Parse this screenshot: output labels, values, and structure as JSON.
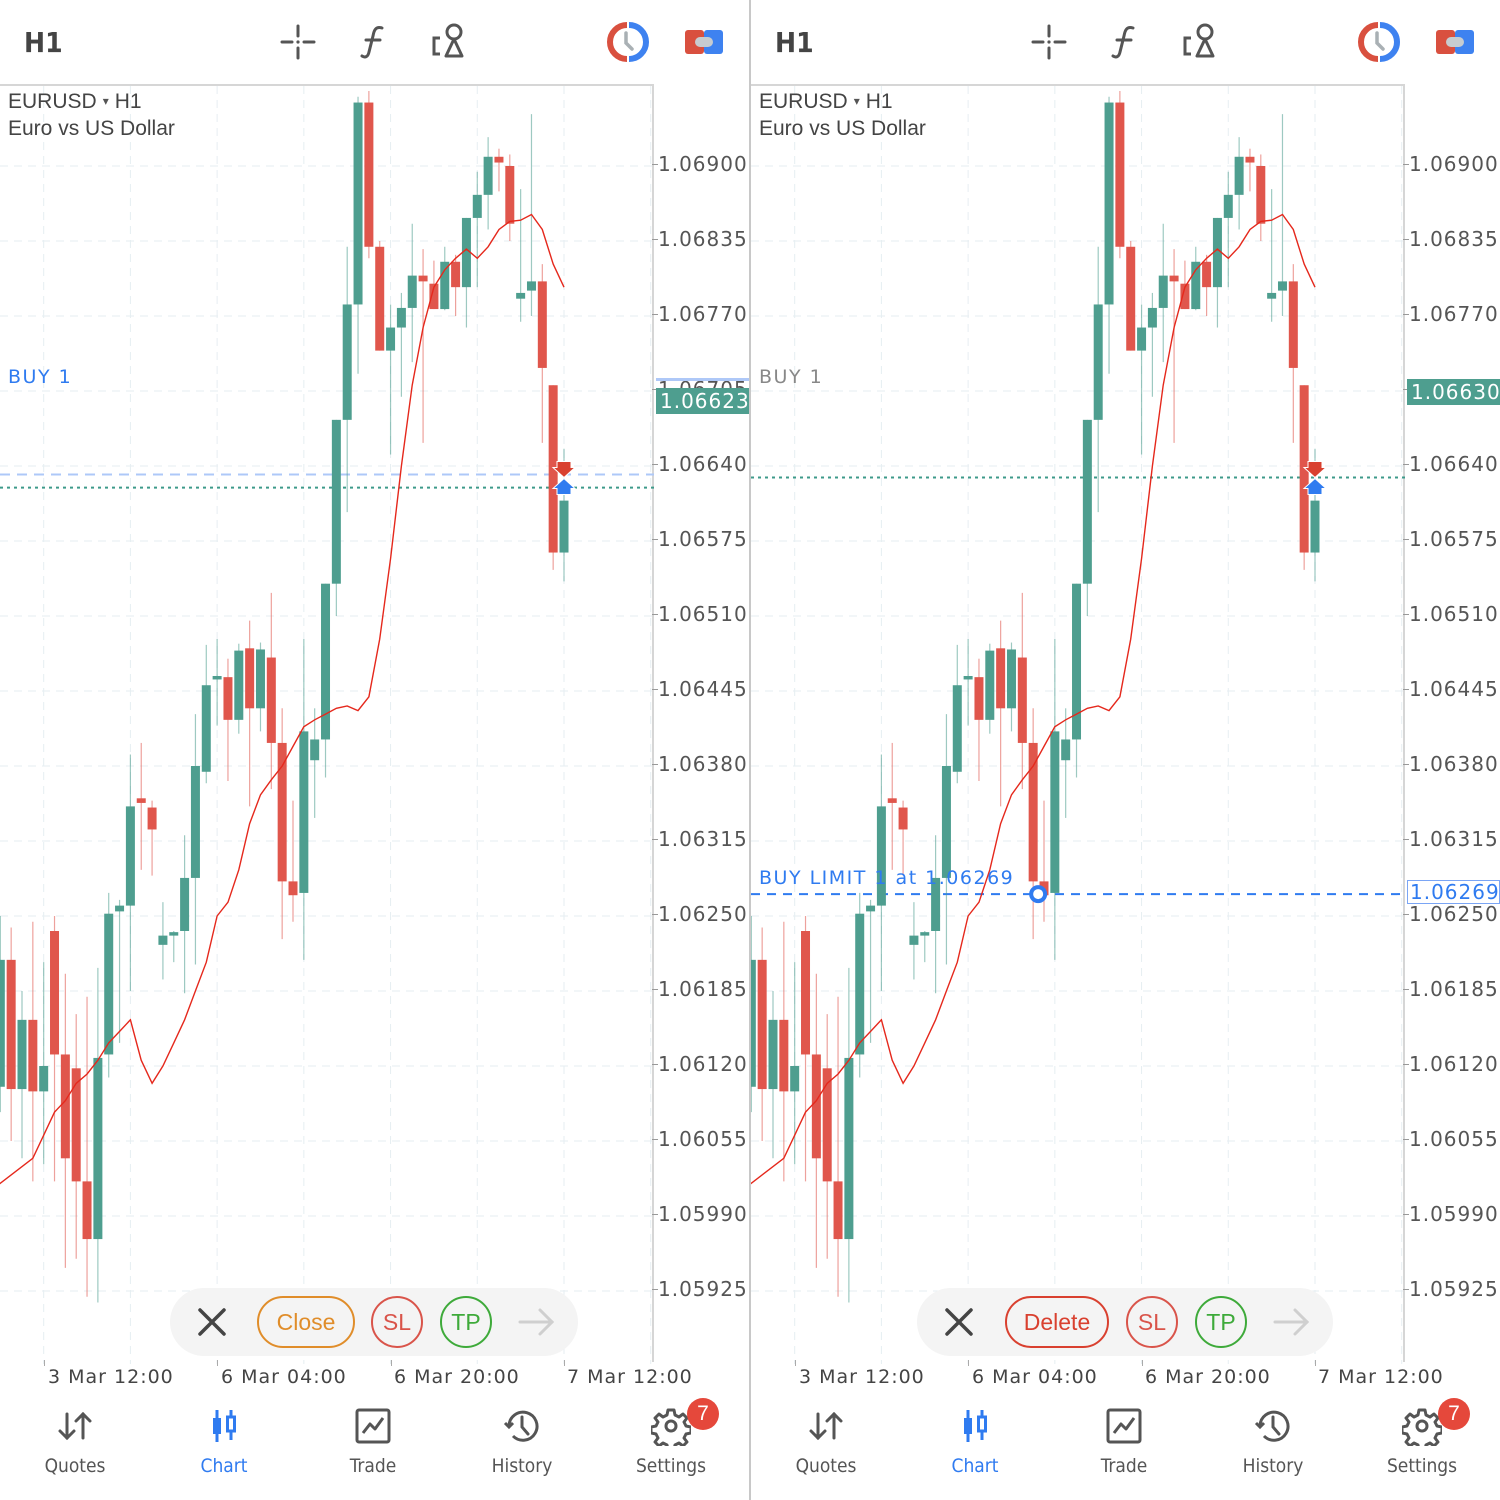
{
  "toolbar": {
    "timeframe": "H1",
    "icons": [
      "crosshair-icon",
      "indicators-f-icon",
      "objects-icon",
      "one-click-trading-icon",
      "chart-window-icon"
    ]
  },
  "symbol": {
    "name": "EURUSD",
    "dropdown_glyph": "▾",
    "timeframe": "H1",
    "description": "Euro vs US Dollar"
  },
  "colors": {
    "bull": "#4e9e8f",
    "bear": "#e0564c",
    "ma_line": "#e5281c",
    "buy_line": "#aec8f8",
    "bid_line": "#3d9a8a",
    "pending": "#2f7bf0",
    "close_btn": "#e08d2a",
    "delete_btn": "#d9402f",
    "sl_btn": "#d9544a",
    "tp_btn": "#3eaa3a",
    "active_tab": "#2f7bf0"
  },
  "chart_data": {
    "type": "candlestick",
    "symbol": "EURUSD",
    "timeframe": "H1",
    "y_ticks": [
      "1.06900",
      "1.06835",
      "1.06770",
      "1.06705",
      "1.06640",
      "1.06575",
      "1.06510",
      "1.06445",
      "1.06380",
      "1.06315",
      "1.06250",
      "1.06185",
      "1.06120",
      "1.06055",
      "1.05990",
      "1.05925"
    ],
    "ylim": [
      1.05865,
      1.06991
    ],
    "x_ticks": [
      "3 Mar 12:00",
      "6 Mar 04:00",
      "6 Mar 20:00",
      "7 Mar 12:00"
    ],
    "x_tick_bar_index": [
      4,
      20,
      36,
      52
    ],
    "candles": [
      {
        "o": 1.061,
        "h": 1.0623,
        "l": 1.0609,
        "c": 1.06212
      },
      {
        "o": 1.06212,
        "h": 1.06235,
        "l": 1.06095,
        "c": 1.061
      },
      {
        "o": 1.06102,
        "h": 1.0625,
        "l": 1.0608,
        "c": 1.06212
      },
      {
        "o": 1.06212,
        "h": 1.0624,
        "l": 1.06055,
        "c": 1.061
      },
      {
        "o": 1.061,
        "h": 1.06185,
        "l": 1.0604,
        "c": 1.0616
      },
      {
        "o": 1.0616,
        "h": 1.06245,
        "l": 1.0602,
        "c": 1.06098
      },
      {
        "o": 1.06098,
        "h": 1.0621,
        "l": 1.06035,
        "c": 1.0612
      },
      {
        "o": 1.06237,
        "h": 1.0625,
        "l": 1.0602,
        "c": 1.0613
      },
      {
        "o": 1.0613,
        "h": 1.062,
        "l": 1.05945,
        "c": 1.0604
      },
      {
        "o": 1.06118,
        "h": 1.06165,
        "l": 1.05953,
        "c": 1.0602
      },
      {
        "o": 1.0602,
        "h": 1.0618,
        "l": 1.0592,
        "c": 1.0597
      },
      {
        "o": 1.0597,
        "h": 1.06205,
        "l": 1.05915,
        "c": 1.06127
      },
      {
        "o": 1.0613,
        "h": 1.0627,
        "l": 1.0611,
        "c": 1.06252
      },
      {
        "o": 1.06254,
        "h": 1.06264,
        "l": 1.0614,
        "c": 1.06259
      },
      {
        "o": 1.06259,
        "h": 1.0639,
        "l": 1.06185,
        "c": 1.06345
      },
      {
        "o": 1.06352,
        "h": 1.064,
        "l": 1.0629,
        "c": 1.06348
      },
      {
        "o": 1.06344,
        "h": 1.0635,
        "l": 1.06285,
        "c": 1.06325
      },
      {
        "o": 1.06225,
        "h": 1.06262,
        "l": 1.06195,
        "c": 1.06233
      },
      {
        "o": 1.06233,
        "h": 1.06237,
        "l": 1.0621,
        "c": 1.06236
      },
      {
        "o": 1.06237,
        "h": 1.0632,
        "l": 1.06183,
        "c": 1.06283
      },
      {
        "o": 1.06283,
        "h": 1.06425,
        "l": 1.06208,
        "c": 1.0638
      },
      {
        "o": 1.06375,
        "h": 1.06485,
        "l": 1.06365,
        "c": 1.0645
      },
      {
        "o": 1.06455,
        "h": 1.0649,
        "l": 1.06415,
        "c": 1.06458
      },
      {
        "o": 1.06457,
        "h": 1.06473,
        "l": 1.06367,
        "c": 1.0642
      },
      {
        "o": 1.0642,
        "h": 1.06486,
        "l": 1.06408,
        "c": 1.0648
      },
      {
        "o": 1.06482,
        "h": 1.06506,
        "l": 1.06345,
        "c": 1.0643
      },
      {
        "o": 1.0643,
        "h": 1.06487,
        "l": 1.0641,
        "c": 1.06481
      },
      {
        "o": 1.06474,
        "h": 1.0653,
        "l": 1.0636,
        "c": 1.064
      },
      {
        "o": 1.064,
        "h": 1.0643,
        "l": 1.0623,
        "c": 1.0628
      },
      {
        "o": 1.0628,
        "h": 1.0635,
        "l": 1.06245,
        "c": 1.06268
      },
      {
        "o": 1.0627,
        "h": 1.0649,
        "l": 1.06212,
        "c": 1.0641
      },
      {
        "o": 1.06385,
        "h": 1.0643,
        "l": 1.06335,
        "c": 1.06403
      },
      {
        "o": 1.06403,
        "h": 1.065,
        "l": 1.0637,
        "c": 1.06538
      },
      {
        "o": 1.06538,
        "h": 1.066,
        "l": 1.0651,
        "c": 1.0668
      },
      {
        "o": 1.0668,
        "h": 1.0683,
        "l": 1.066,
        "c": 1.0678
      },
      {
        "o": 1.0678,
        "h": 1.0696,
        "l": 1.0672,
        "c": 1.06955
      },
      {
        "o": 1.06955,
        "h": 1.06965,
        "l": 1.0682,
        "c": 1.0683
      },
      {
        "o": 1.0683,
        "h": 1.06835,
        "l": 1.0674,
        "c": 1.0674
      },
      {
        "o": 1.0674,
        "h": 1.0678,
        "l": 1.0665,
        "c": 1.0676
      },
      {
        "o": 1.0676,
        "h": 1.0679,
        "l": 1.067,
        "c": 1.06777
      },
      {
        "o": 1.06777,
        "h": 1.0685,
        "l": 1.0673,
        "c": 1.06805
      },
      {
        "o": 1.06805,
        "h": 1.06828,
        "l": 1.0666,
        "c": 1.068
      },
      {
        "o": 1.06798,
        "h": 1.06818,
        "l": 1.06776,
        "c": 1.06776
      },
      {
        "o": 1.06776,
        "h": 1.0683,
        "l": 1.06775,
        "c": 1.06817
      },
      {
        "o": 1.06817,
        "h": 1.06823,
        "l": 1.0677,
        "c": 1.06795
      },
      {
        "o": 1.06795,
        "h": 1.06855,
        "l": 1.0676,
        "c": 1.06855
      },
      {
        "o": 1.06855,
        "h": 1.06895,
        "l": 1.06795,
        "c": 1.06875
      },
      {
        "o": 1.06875,
        "h": 1.06925,
        "l": 1.06845,
        "c": 1.06908
      },
      {
        "o": 1.06908,
        "h": 1.06915,
        "l": 1.06878,
        "c": 1.06903
      },
      {
        "o": 1.069,
        "h": 1.0691,
        "l": 1.06835,
        "c": 1.0685
      },
      {
        "o": 1.06785,
        "h": 1.0688,
        "l": 1.06765,
        "c": 1.0679
      },
      {
        "o": 1.06792,
        "h": 1.06945,
        "l": 1.0677,
        "c": 1.068
      },
      {
        "o": 1.068,
        "h": 1.06815,
        "l": 1.0666,
        "c": 1.06725
      },
      {
        "o": 1.0671,
        "h": 1.06655,
        "l": 1.0655,
        "c": 1.06565
      },
      {
        "o": 1.06565,
        "h": 1.06655,
        "l": 1.0654,
        "c": 1.0661
      }
    ],
    "ma_series": [
      1.0604,
      1.0606,
      1.0608,
      1.0609,
      1.06105,
      1.06113,
      1.06125,
      1.0614,
      1.0615,
      1.0616,
      1.06125,
      1.06105,
      1.0612,
      1.0614,
      1.0616,
      1.06185,
      1.0621,
      1.0625,
      1.06262,
      1.0629,
      1.0633,
      1.06355,
      1.06368,
      1.0638,
      1.06397,
      1.06414,
      1.0642,
      1.06425,
      1.0643,
      1.06432,
      1.06428,
      1.0644,
      1.0649,
      1.0656,
      1.0664,
      1.0671,
      1.0676,
      1.06795,
      1.0681,
      1.0682,
      1.06828,
      1.0682,
      1.0683,
      1.06845,
      1.06852,
      1.06853,
      1.06858,
      1.06845,
      1.06815,
      1.06795
    ],
    "ma_offset": 0
  },
  "left": {
    "position_label": "BUY 1",
    "position_price": 1.0663,
    "bid_price": 1.06623,
    "bid_label": "1.06623",
    "overlap_tick": "1.06640",
    "actions": {
      "close": "×",
      "primary": "Close",
      "sl": "SL",
      "tp": "TP",
      "next": "→"
    }
  },
  "right": {
    "position_label": "BUY 1",
    "position_price": 1.0663,
    "bid_price": 1.0663,
    "bid_label": "1.06630",
    "overlap_tick": "1.06640",
    "pending_label": "BUY LIMIT 1 at 1.06269",
    "pending_price": 1.06269,
    "pending_tag": "1.06269",
    "actions": {
      "close": "×",
      "primary": "Delete",
      "sl": "SL",
      "tp": "TP",
      "next": "→"
    }
  },
  "nav": [
    {
      "label": "Quotes",
      "icon": "quotes-arrows-icon",
      "active": false
    },
    {
      "label": "Chart",
      "icon": "candlestick-chart-icon",
      "active": true
    },
    {
      "label": "Trade",
      "icon": "trade-chart-icon",
      "active": false
    },
    {
      "label": "History",
      "icon": "history-clock-icon",
      "active": false
    },
    {
      "label": "Settings",
      "icon": "settings-gear-icon",
      "active": false,
      "badge": "7"
    }
  ]
}
